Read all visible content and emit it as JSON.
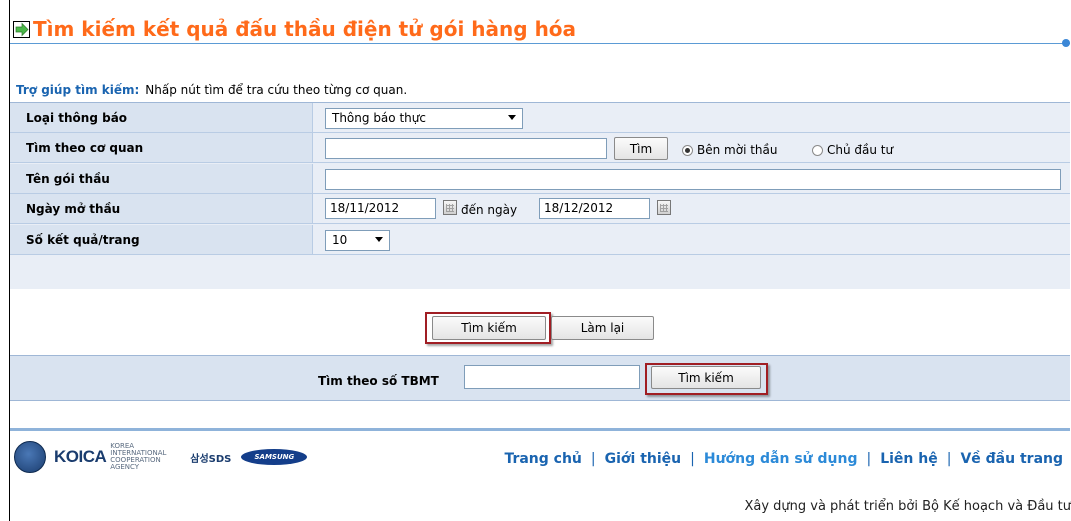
{
  "page": {
    "title": "Tìm kiếm kết quả đấu thầu điện tử gói hàng hóa",
    "icon": "green-arrow-icon"
  },
  "help": {
    "label": "Trợ giúp tìm kiếm:",
    "text": "Nhấp nút tìm để tra cứu theo từng cơ quan."
  },
  "form": {
    "rows": [
      {
        "label": "Loại thông báo"
      },
      {
        "label": "Tìm theo cơ quan"
      },
      {
        "label": "Tên gói thầu"
      },
      {
        "label": "Ngày mở thầu"
      },
      {
        "label": "Số kết quả/trang"
      }
    ],
    "notice_type": {
      "selected": "Thông báo thực"
    },
    "agency": {
      "value": "",
      "button": "Tìm",
      "radio_bidder": "Bên mời thầu",
      "radio_investor": "Chủ đầu tư",
      "selected": "Bên mời thầu"
    },
    "package_name": {
      "value": ""
    },
    "open_date": {
      "from": "18/11/2012",
      "to_label": "đến ngày",
      "to": "18/12/2012"
    },
    "per_page": {
      "selected": "10"
    },
    "search_button": "Tìm kiếm",
    "reset_button": "Làm lại"
  },
  "tbmt": {
    "label": "Tìm theo số TBMT",
    "value": "",
    "button": "Tìm kiếm"
  },
  "footer": {
    "logos": {
      "koica": "KOICA",
      "koica_sub": "KOREA INTERNATIONAL COOPERATION AGENCY",
      "sds": "삼성SDS",
      "samsung": "SAMSUNG"
    },
    "nav": [
      "Trang chủ",
      "Giới thiệu",
      "Hướng dẫn sử dụng",
      "Liên hệ",
      "Về đầu trang"
    ],
    "credit": "Xây dựng và phát triển bởi Bộ Kế hoạch và Đầu tư"
  },
  "colors": {
    "title": "#ff6a1a",
    "link": "#1a64b0",
    "highlight": "#a01e24"
  }
}
